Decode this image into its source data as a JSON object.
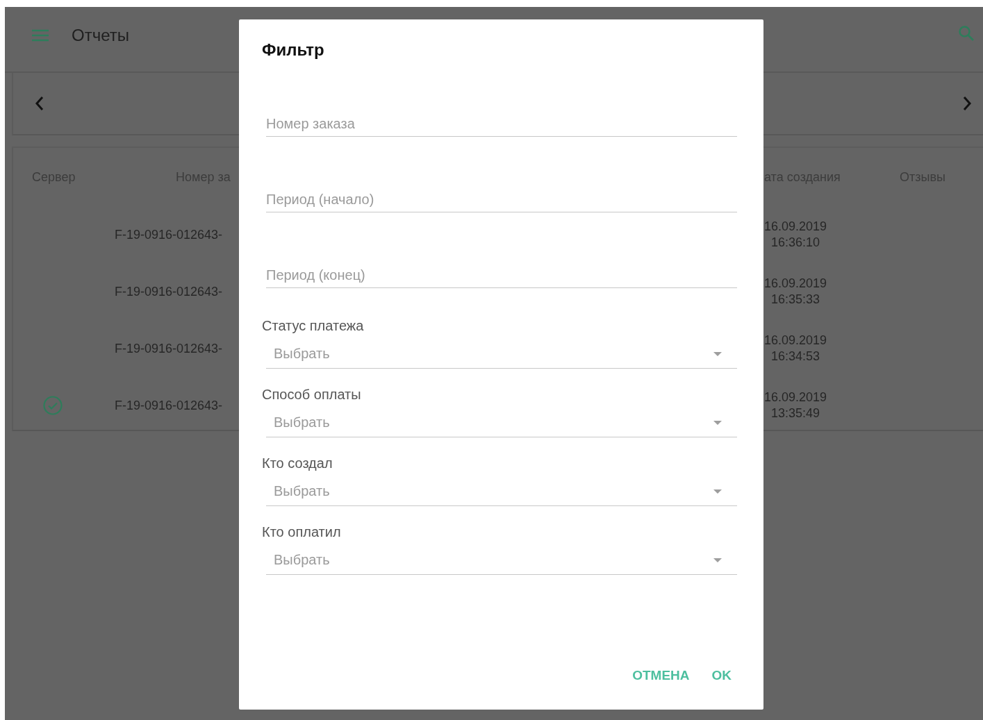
{
  "toolbar": {
    "title": "Отчеты"
  },
  "table": {
    "columns": [
      "Сервер",
      "Номер за",
      "ата создания",
      "Отзывы"
    ],
    "rows": [
      {
        "synced": false,
        "order": "F-19-0916-012643-",
        "date": "16.09.2019",
        "time": "16:36:10"
      },
      {
        "synced": false,
        "order": "F-19-0916-012643-",
        "date": "16.09.2019",
        "time": "16:35:33"
      },
      {
        "synced": false,
        "order": "F-19-0916-012643-",
        "date": "16.09.2019",
        "time": "16:34:53"
      },
      {
        "synced": true,
        "order": "F-19-0916-012643-",
        "date": "16.09.2019",
        "time": "13:35:49"
      }
    ]
  },
  "dialog": {
    "title": "Фильтр",
    "fields": [
      {
        "kind": "text",
        "placeholder": "Номер заказа"
      },
      {
        "kind": "text",
        "placeholder": "Период (начало)"
      },
      {
        "kind": "text",
        "placeholder": "Период (конец)"
      },
      {
        "kind": "select",
        "label": "Статус платежа",
        "placeholder": "Выбрать"
      },
      {
        "kind": "select",
        "label": "Способ оплаты",
        "placeholder": "Выбрать"
      },
      {
        "kind": "select",
        "label": "Кто создал",
        "placeholder": "Выбрать"
      },
      {
        "kind": "select",
        "label": "Кто оплатил",
        "placeholder": "Выбрать"
      }
    ],
    "buttons": [
      "ОТМЕНА",
      "OK"
    ]
  }
}
